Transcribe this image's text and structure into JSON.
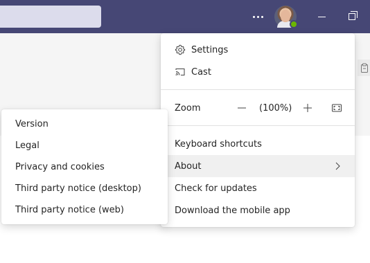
{
  "menu": {
    "settings_label": "Settings",
    "cast_label": "Cast",
    "zoom_label": "Zoom",
    "zoom_value": "(100%)",
    "keyboard_shortcuts_label": "Keyboard shortcuts",
    "about_label": "About",
    "check_updates_label": "Check for updates",
    "download_mobile_label": "Download the mobile app"
  },
  "about_submenu": {
    "items": [
      {
        "label": "Version"
      },
      {
        "label": "Legal"
      },
      {
        "label": "Privacy and cookies"
      },
      {
        "label": "Third party notice (desktop)"
      },
      {
        "label": "Third party notice (web)"
      }
    ]
  },
  "icons": {
    "more": "more-icon",
    "settings": "gear-icon",
    "cast": "cast-icon",
    "zoom_out": "minus-icon",
    "zoom_in": "plus-icon",
    "fullscreen": "fullscreen-icon",
    "about_chevron": "chevron-right-icon",
    "minimize": "minimize-icon",
    "restore": "restore-icon"
  },
  "colors": {
    "titlebar": "#464775",
    "search_box": "#dcdcec",
    "presence_available": "#6bb700",
    "menu_hover": "#f0f0f0"
  }
}
